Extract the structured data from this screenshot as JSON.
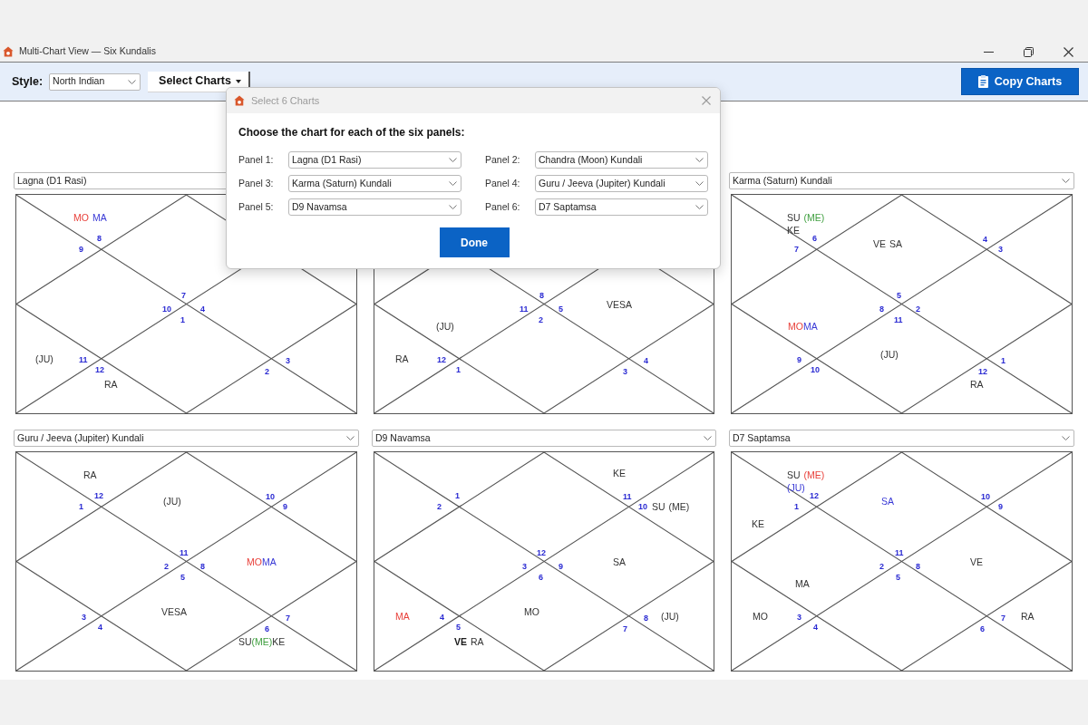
{
  "window": {
    "title": "Multi-Chart View — Six Kundalis"
  },
  "toolbar": {
    "style_label": "Style:",
    "style_value": "North Indian",
    "select_charts": "Select Charts",
    "copy_charts": "Copy Charts"
  },
  "charts": [
    {
      "title": "Lagna (D1 Rasi)",
      "lagna": {
        "sign": "7"
      },
      "houses": [
        {
          "sign": "8",
          "lines": [
            {
              "words": [
                [
                  {
                    "text": "MO",
                    "color": "#e8403a"
                  }
                ],
                [
                  {
                    "text": "MA",
                    "color": "#3a3ad6"
                  }
                ]
              ]
            }
          ]
        },
        {
          "sign": "9"
        },
        {
          "sign": "10"
        },
        {
          "sign": "4"
        },
        {
          "sign": "1"
        },
        {
          "sign": "11",
          "lines": [
            {
              "words": [
                [
                  {
                    "text": "(JU)",
                    "color": "#333333"
                  }
                ]
              ]
            }
          ]
        },
        {
          "sign": "3"
        },
        {
          "sign": "12",
          "lines": [
            {
              "words": [
                [
                  {
                    "text": "RA",
                    "color": "#333333"
                  }
                ]
              ]
            }
          ]
        },
        {
          "sign": "2"
        }
      ]
    },
    {
      "lagna": {
        "sign": "8"
      },
      "houses": [
        {
          "sign": "11",
          "lines": [
            {
              "words": [
                [
                  {
                    "text": "(JU)",
                    "color": "#333333"
                  }
                ]
              ]
            }
          ]
        },
        {
          "sign": "5",
          "lines": [
            {
              "words": [
                [
                  {
                    "text": "VE",
                    "color": "#333333"
                  },
                  {
                    "text": "SA",
                    "color": "#333333"
                  }
                ]
              ]
            }
          ]
        },
        {
          "sign": "2"
        },
        {
          "sign": "12",
          "lines": [
            {
              "words": [
                [
                  {
                    "text": "RA",
                    "color": "#333333"
                  }
                ]
              ]
            }
          ]
        },
        {
          "sign": "4"
        },
        {
          "sign": "1"
        },
        {
          "sign": "3"
        }
      ]
    },
    {
      "title": "Karma (Saturn) Kundali",
      "lagna": {
        "sign": "5",
        "lines": [
          {
            "words": [
              [
                {
                  "text": "VE",
                  "color": "#333333"
                }
              ],
              [
                {
                  "text": "SA",
                  "color": "#333333"
                }
              ]
            ]
          }
        ]
      },
      "houses": [
        {
          "sign": "6",
          "lines": [
            {
              "words": [
                [
                  {
                    "text": "SU",
                    "color": "#333333"
                  }
                ],
                [
                  {
                    "text": "(ME)",
                    "color": "#3f9f3f"
                  }
                ]
              ]
            },
            {
              "words": [
                [
                  {
                    "text": "KE",
                    "color": "#333333"
                  }
                ]
              ]
            }
          ]
        },
        {
          "sign": "4"
        },
        {
          "sign": "7"
        },
        {
          "sign": "3"
        },
        {
          "sign": "8",
          "lines": [
            {
              "words": [
                [
                  {
                    "text": "MO",
                    "color": "#e8403a"
                  },
                  {
                    "text": "MA",
                    "color": "#3a3ad6"
                  }
                ]
              ]
            }
          ]
        },
        {
          "sign": "2"
        },
        {
          "sign": "11",
          "lines": [
            {
              "words": [
                [
                  {
                    "text": "(JU)",
                    "color": "#333333"
                  }
                ]
              ]
            }
          ]
        },
        {
          "sign": "9"
        },
        {
          "sign": "1"
        },
        {
          "sign": "10"
        },
        {
          "sign": "12",
          "lines": [
            {
              "words": [
                [
                  {
                    "text": "RA",
                    "color": "#333333"
                  }
                ]
              ]
            }
          ]
        }
      ]
    },
    {
      "title": "Guru / Jeeva (Jupiter) Kundali",
      "lagna": {
        "sign": "11",
        "lines": [
          {
            "words": [
              [
                {
                  "text": "(JU)",
                  "color": "#333333"
                }
              ]
            ]
          }
        ]
      },
      "houses": [
        {
          "sign": "12",
          "lines": [
            {
              "words": [
                [
                  {
                    "text": "RA",
                    "color": "#333333"
                  }
                ]
              ]
            }
          ]
        },
        {
          "sign": "10"
        },
        {
          "sign": "1"
        },
        {
          "sign": "9"
        },
        {
          "sign": "2"
        },
        {
          "sign": "8",
          "lines": [
            {
              "words": [
                [
                  {
                    "text": "MO",
                    "color": "#e8403a"
                  },
                  {
                    "text": "MA",
                    "color": "#3a3ad6"
                  }
                ]
              ]
            }
          ]
        },
        {
          "sign": "5",
          "lines": [
            {
              "words": [
                [
                  {
                    "text": "VE",
                    "color": "#333333"
                  },
                  {
                    "text": "SA",
                    "color": "#333333"
                  }
                ]
              ]
            }
          ]
        },
        {
          "sign": "3"
        },
        {
          "sign": "7"
        },
        {
          "sign": "4"
        },
        {
          "sign": "6",
          "lines": [
            {
              "words": [
                [
                  {
                    "text": "SU",
                    "color": "#333333"
                  },
                  {
                    "text": "(ME)",
                    "color": "#3f9f3f"
                  },
                  {
                    "text": "KE",
                    "color": "#333333"
                  }
                ]
              ]
            }
          ]
        }
      ]
    },
    {
      "title": "D9 Navamsa",
      "lagna": {
        "sign": "12"
      },
      "houses": [
        {
          "sign": "1"
        },
        {
          "sign": "11",
          "lines": [
            {
              "words": [
                [
                  {
                    "text": "KE",
                    "color": "#333333"
                  }
                ]
              ]
            }
          ]
        },
        {
          "sign": "2"
        },
        {
          "sign": "10",
          "lines": [
            {
              "words": [
                [
                  {
                    "text": "SU",
                    "color": "#333333"
                  }
                ],
                [
                  {
                    "text": "(ME)",
                    "color": "#333333"
                  }
                ]
              ]
            }
          ]
        },
        {
          "sign": "3"
        },
        {
          "sign": "9",
          "lines": [
            {
              "words": [
                [
                  {
                    "text": "SA",
                    "color": "#333333"
                  }
                ]
              ]
            }
          ]
        },
        {
          "sign": "6",
          "lines": [
            {
              "words": [
                [
                  {
                    "text": "MO",
                    "color": "#333333"
                  }
                ]
              ]
            }
          ]
        },
        {
          "sign": "4",
          "lines": [
            {
              "words": [
                [
                  {
                    "text": "MA",
                    "color": "#e8403a"
                  }
                ]
              ]
            }
          ]
        },
        {
          "sign": "8",
          "lines": [
            {
              "words": [
                [
                  {
                    "text": "(JU)",
                    "color": "#333333"
                  }
                ]
              ]
            }
          ]
        },
        {
          "sign": "5",
          "lines": [
            {
              "words": [
                [
                  {
                    "text": "VE",
                    "color": "#1a1a1a",
                    "bold": true
                  }
                ],
                [
                  {
                    "text": "RA",
                    "color": "#333333"
                  }
                ]
              ]
            }
          ]
        },
        {
          "sign": "7"
        }
      ]
    },
    {
      "title": "D7 Saptamsa",
      "lagna": {
        "sign": "11",
        "lines": [
          {
            "words": [
              [
                {
                  "text": "SA",
                  "color": "#3a3ad6"
                }
              ]
            ]
          }
        ]
      },
      "houses": [
        {
          "sign": "12",
          "lines": [
            {
              "words": [
                [
                  {
                    "text": "SU",
                    "color": "#333333"
                  }
                ],
                [
                  {
                    "text": "(ME)",
                    "color": "#e8403a"
                  }
                ]
              ]
            },
            {
              "words": [
                [
                  {
                    "text": "(JU)",
                    "color": "#3a3ad6"
                  }
                ]
              ]
            }
          ]
        },
        {
          "sign": "10"
        },
        {
          "sign": "1",
          "lines": [
            {
              "words": [
                [
                  {
                    "text": "KE",
                    "color": "#333333"
                  }
                ]
              ]
            }
          ]
        },
        {
          "sign": "9"
        },
        {
          "sign": "2",
          "lines": [
            {
              "words": [
                [
                  {
                    "text": "MA",
                    "color": "#333333"
                  }
                ]
              ]
            }
          ]
        },
        {
          "sign": "8",
          "lines": [
            {
              "words": [
                [
                  {
                    "text": "VE",
                    "color": "#333333"
                  }
                ]
              ]
            }
          ]
        },
        {
          "sign": "5"
        },
        {
          "sign": "3",
          "lines": [
            {
              "words": [
                [
                  {
                    "text": "MO",
                    "color": "#333333"
                  }
                ]
              ]
            }
          ]
        },
        {
          "sign": "7",
          "lines": [
            {
              "words": [
                [
                  {
                    "text": "RA",
                    "color": "#333333"
                  }
                ]
              ]
            }
          ]
        },
        {
          "sign": "4"
        },
        {
          "sign": "6"
        }
      ]
    }
  ],
  "dialog": {
    "title": "Select 6 Charts",
    "heading": "Choose the chart for each of the six panels:",
    "panels": [
      {
        "label": "Panel 1:",
        "value": "Lagna (D1 Rasi)"
      },
      {
        "label": "Panel 2:",
        "value": "Chandra (Moon) Kundali"
      },
      {
        "label": "Panel 3:",
        "value": "Karma (Saturn) Kundali"
      },
      {
        "label": "Panel 4:",
        "value": "Guru / Jeeva (Jupiter) Kundali"
      },
      {
        "label": "Panel 5:",
        "value": "D9 Navamsa"
      },
      {
        "label": "Panel 6:",
        "value": "D7 Saptamsa"
      }
    ],
    "done": "Done"
  }
}
